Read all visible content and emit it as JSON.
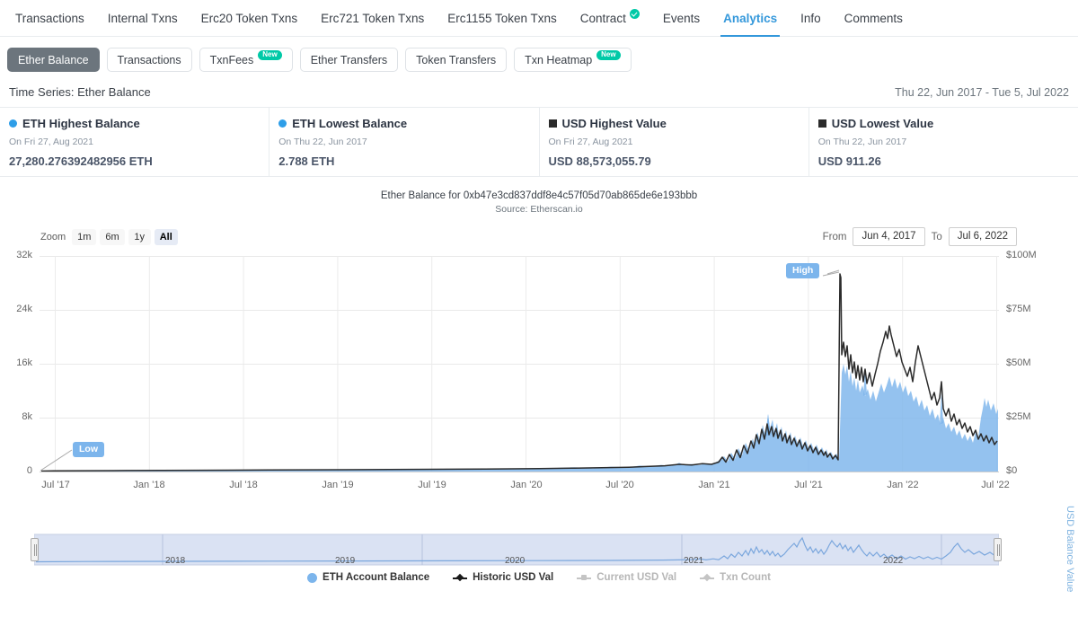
{
  "topnav": {
    "items": [
      {
        "label": "Transactions",
        "active": false,
        "verified": false
      },
      {
        "label": "Internal Txns",
        "active": false,
        "verified": false
      },
      {
        "label": "Erc20 Token Txns",
        "active": false,
        "verified": false
      },
      {
        "label": "Erc721 Token Txns",
        "active": false,
        "verified": false
      },
      {
        "label": "Erc1155 Token Txns",
        "active": false,
        "verified": false
      },
      {
        "label": "Contract",
        "active": false,
        "verified": true
      },
      {
        "label": "Events",
        "active": false,
        "verified": false
      },
      {
        "label": "Analytics",
        "active": true,
        "verified": false
      },
      {
        "label": "Info",
        "active": false,
        "verified": false
      },
      {
        "label": "Comments",
        "active": false,
        "verified": false
      }
    ]
  },
  "subtabs": [
    {
      "label": "Ether Balance",
      "active": true,
      "badge": null
    },
    {
      "label": "Transactions",
      "active": false,
      "badge": null
    },
    {
      "label": "TxnFees",
      "active": false,
      "badge": "New"
    },
    {
      "label": "Ether Transfers",
      "active": false,
      "badge": null
    },
    {
      "label": "Token Transfers",
      "active": false,
      "badge": null
    },
    {
      "label": "Txn Heatmap",
      "active": false,
      "badge": "New"
    }
  ],
  "timeseries": {
    "title": "Time Series: Ether Balance",
    "range": "Thu 22, Jun 2017 - Tue 5, Jul 2022"
  },
  "cards": [
    {
      "marker": "dot-blue",
      "title": "ETH Highest Balance",
      "date": "On Fri 27, Aug 2021",
      "value": "27,280.276392482956 ETH"
    },
    {
      "marker": "dot-blue",
      "title": "ETH Lowest Balance",
      "date": "On Thu 22, Jun 2017",
      "value": "2.788 ETH"
    },
    {
      "marker": "sq-black",
      "title": "USD Highest Value",
      "date": "On Fri 27, Aug 2021",
      "value": "USD 88,573,055.79"
    },
    {
      "marker": "sq-black",
      "title": "USD Lowest Value",
      "date": "On Thu 22, Jun 2017",
      "value": "USD 911.26"
    }
  ],
  "controls": {
    "zoom_label": "Zoom",
    "zoom_buttons": [
      {
        "label": "1m",
        "active": false
      },
      {
        "label": "6m",
        "active": false
      },
      {
        "label": "1y",
        "active": false
      },
      {
        "label": "All",
        "active": true
      }
    ],
    "from_label": "From",
    "from_value": "Jun 4, 2017",
    "to_label": "To",
    "to_value": "Jul 6, 2022"
  },
  "colors": {
    "accent": "#3498db",
    "eth_area": "#7cb5ec",
    "usd_line": "#1a1a1a",
    "verified": "#00c9a7",
    "flag": "#7cb5ec"
  },
  "chart_data": {
    "type": "area",
    "title": "Ether Balance for 0xb47e3cd837ddf8e4c57f05d70ab865de6e193bbb",
    "subtitle": "Source: Etherscan.io",
    "xlabel": "",
    "ylabel": "",
    "y2label": "USD Balance Value",
    "grid": true,
    "legend_position": "bottom",
    "xticks": [
      "Jul '17",
      "Jan '18",
      "Jul '18",
      "Jan '19",
      "Jul '19",
      "Jan '20",
      "Jul '20",
      "Jan '21",
      "Jul '21",
      "Jan '22",
      "Jul '22"
    ],
    "yticks_left": [
      "0",
      "8k",
      "16k",
      "24k",
      "32k"
    ],
    "ylim_left": [
      0,
      32000
    ],
    "yticks_right": [
      "$0",
      "$25M",
      "$50M",
      "$75M",
      "$100M"
    ],
    "ylim_right": [
      0,
      100000000
    ],
    "annotations": [
      {
        "label": "High",
        "series": "Historic USD Val",
        "x": "Aug 2021",
        "value": 88573055.79
      },
      {
        "label": "Low",
        "series": "ETH Account Balance",
        "x": "Jun 2017",
        "value": 2.788
      }
    ],
    "legend": [
      {
        "name": "ETH Account Balance",
        "marker": "circle",
        "color": "#7cb5ec",
        "enabled": true
      },
      {
        "name": "Historic USD Val",
        "marker": "line",
        "color": "#1a1a1a",
        "enabled": true
      },
      {
        "name": "Current USD Val",
        "marker": "square-line",
        "color": "#c4c4c4",
        "enabled": false
      },
      {
        "name": "Txn Count",
        "marker": "line",
        "color": "#c4c4c4",
        "enabled": false
      }
    ],
    "series": [
      {
        "name": "ETH Account Balance",
        "axis": "left",
        "unit": "ETH",
        "x": [
          "2017-07",
          "2017-10",
          "2018-01",
          "2018-04",
          "2018-07",
          "2018-10",
          "2019-01",
          "2019-04",
          "2019-07",
          "2019-10",
          "2020-01",
          "2020-04",
          "2020-07",
          "2020-10",
          "2021-01",
          "2021-02",
          "2021-03",
          "2021-04",
          "2021-05",
          "2021-06",
          "2021-07",
          "2021-08",
          "2021-09",
          "2021-10",
          "2021-11",
          "2021-12",
          "2022-01",
          "2022-02",
          "2022-03",
          "2022-04",
          "2022-05",
          "2022-06",
          "2022-07"
        ],
        "values": [
          3,
          20,
          40,
          60,
          80,
          110,
          140,
          170,
          200,
          240,
          300,
          380,
          520,
          900,
          2600,
          3900,
          6200,
          4800,
          5500,
          4200,
          5800,
          13600,
          11200,
          12600,
          14200,
          12000,
          10400,
          9800,
          8800,
          7200,
          6400,
          9000,
          7800
        ]
      },
      {
        "name": "Historic USD Val",
        "axis": "right",
        "unit": "USD",
        "x": [
          "2017-07",
          "2017-10",
          "2018-01",
          "2018-04",
          "2018-07",
          "2018-10",
          "2019-01",
          "2019-04",
          "2019-07",
          "2019-10",
          "2020-01",
          "2020-04",
          "2020-07",
          "2020-10",
          "2021-01",
          "2021-02",
          "2021-03",
          "2021-04",
          "2021-05",
          "2021-06",
          "2021-07",
          "2021-08",
          "2021-09",
          "2021-10",
          "2021-11",
          "2021-12",
          "2022-01",
          "2022-02",
          "2022-03",
          "2022-04",
          "2022-05",
          "2022-06",
          "2022-07"
        ],
        "values": [
          911,
          12000,
          55000,
          90000,
          140000,
          180000,
          230000,
          320000,
          450000,
          600000,
          900000,
          1300000,
          2400000,
          5000000,
          11000000,
          15000000,
          20000000,
          16000000,
          19000000,
          13000000,
          20000000,
          88573055,
          34000000,
          43000000,
          56000000,
          42000000,
          38000000,
          45000000,
          33000000,
          24000000,
          17000000,
          20000000,
          13000000
        ]
      }
    ],
    "navigator": {
      "labels": [
        "2018",
        "2019",
        "2020",
        "2021",
        "2022"
      ],
      "selected_start": "Jun 4, 2017",
      "selected_end": "Jul 6, 2022"
    }
  }
}
